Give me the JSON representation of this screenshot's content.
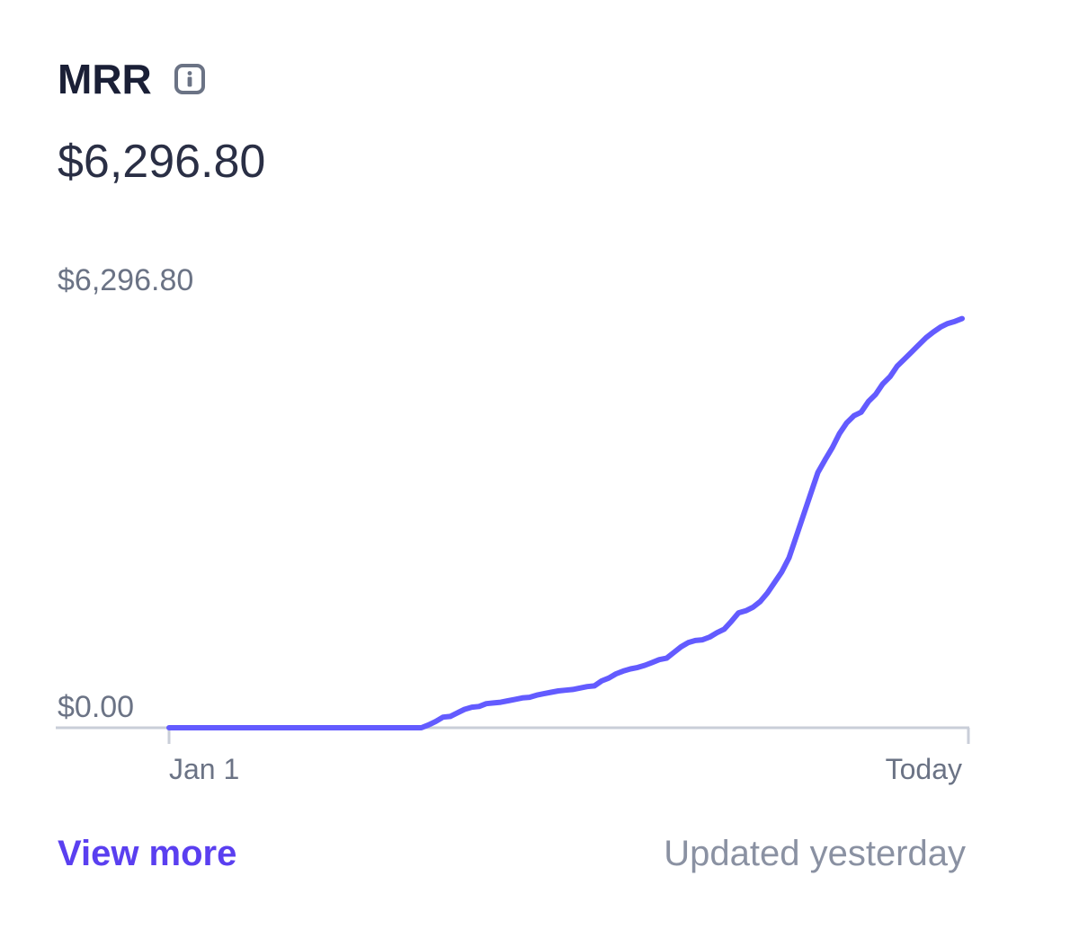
{
  "card": {
    "title": "MRR",
    "info_icon": "info-icon",
    "current_value": "$6,296.80",
    "view_more_label": "View more",
    "updated_text": "Updated yesterday"
  },
  "colors": {
    "line": "#635bff",
    "title": "#1a1f36",
    "link": "#5a3ff0",
    "muted": "#8a91a2",
    "axis": "#c9ced8"
  },
  "chart_data": {
    "type": "line",
    "y_tick_labels": [
      "$6,296.80",
      "$0.00"
    ],
    "x_tick_labels": [
      "Jan 1",
      "Today"
    ],
    "ylim": [
      0,
      6296.8
    ],
    "grid": false,
    "legend": "none",
    "series": [
      {
        "values": [
          0,
          0,
          0,
          0,
          0,
          0,
          0,
          0,
          0,
          0,
          0,
          0,
          0,
          0,
          0,
          0,
          0,
          0,
          0,
          0,
          0,
          0,
          0,
          0,
          0,
          0,
          0,
          0,
          0,
          0,
          0,
          0,
          0,
          0,
          0,
          0,
          40,
          90,
          150,
          160,
          210,
          260,
          290,
          300,
          340,
          350,
          360,
          380,
          400,
          420,
          430,
          460,
          480,
          500,
          520,
          530,
          540,
          560,
          580,
          590,
          660,
          700,
          760,
          800,
          830,
          850,
          880,
          920,
          960,
          980,
          1060,
          1140,
          1200,
          1230,
          1240,
          1280,
          1340,
          1390,
          1500,
          1620,
          1650,
          1700,
          1780,
          1900,
          2050,
          2200,
          2400,
          2700,
          3000,
          3300,
          3600,
          3780,
          3950,
          4150,
          4300,
          4400,
          4450,
          4600,
          4700,
          4850,
          4950,
          5100,
          5200,
          5300,
          5400,
          5500,
          5580,
          5650,
          5700,
          5730,
          5770
        ]
      }
    ]
  }
}
